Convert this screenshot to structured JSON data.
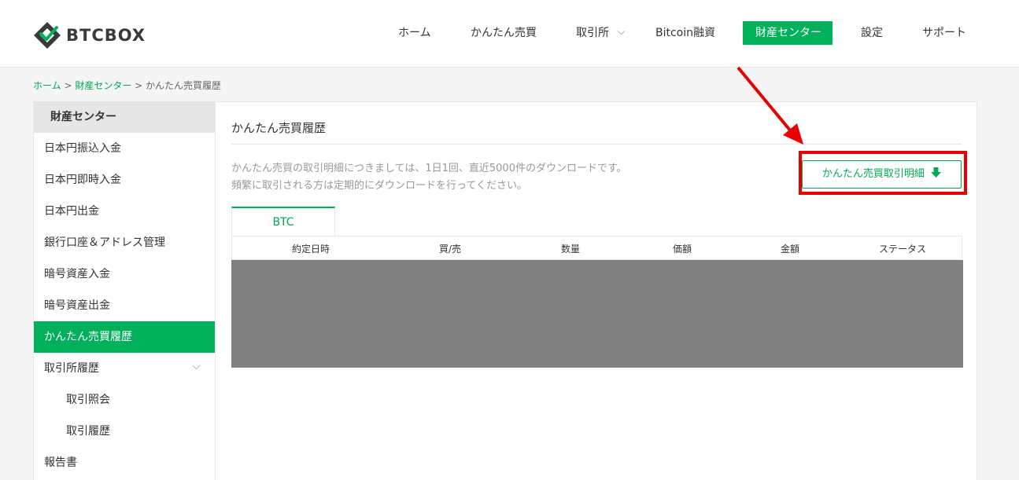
{
  "brand": {
    "name": "BTCBOX"
  },
  "nav": {
    "home": "ホーム",
    "easy_trade": "かんたん売買",
    "exchange": "取引所",
    "bitcoin_loan": "Bitcoin融資",
    "asset_center": "財産センター",
    "settings": "設定",
    "support": "サポート"
  },
  "breadcrumb": {
    "home": "ホーム",
    "sep1": " > ",
    "asset_center": "財産センター",
    "sep2": " > ",
    "current": "かんたん売買履歴"
  },
  "sidebar": {
    "title": "財産センター",
    "items": [
      {
        "label": "日本円振込入金"
      },
      {
        "label": "日本円即時入金"
      },
      {
        "label": "日本円出金"
      },
      {
        "label": "銀行口座＆アドレス管理"
      },
      {
        "label": "暗号資産入金"
      },
      {
        "label": "暗号資産出金"
      },
      {
        "label": "かんたん売買履歴",
        "active": true
      },
      {
        "label": "取引所履歴"
      },
      {
        "label": "取引照会"
      },
      {
        "label": "取引履歴"
      },
      {
        "label": "報告書"
      }
    ]
  },
  "main": {
    "title": "かんたん売買履歴",
    "description_line1": "かんたん売買の取引明細につきましては、1日1回、直近5000件のダウンロードです。",
    "description_line2": "頻繁に取引される方は定期的にダウンロードを行ってください。",
    "download_button": "かんたん売買取引明細",
    "tab": "BTC",
    "table_headers": [
      "約定日時",
      "買/売",
      "数量",
      "価額",
      "金額",
      "ステータス"
    ]
  },
  "colors": {
    "accent": "#00b05a",
    "annotation": "#e60000",
    "redacted": "#808080"
  }
}
